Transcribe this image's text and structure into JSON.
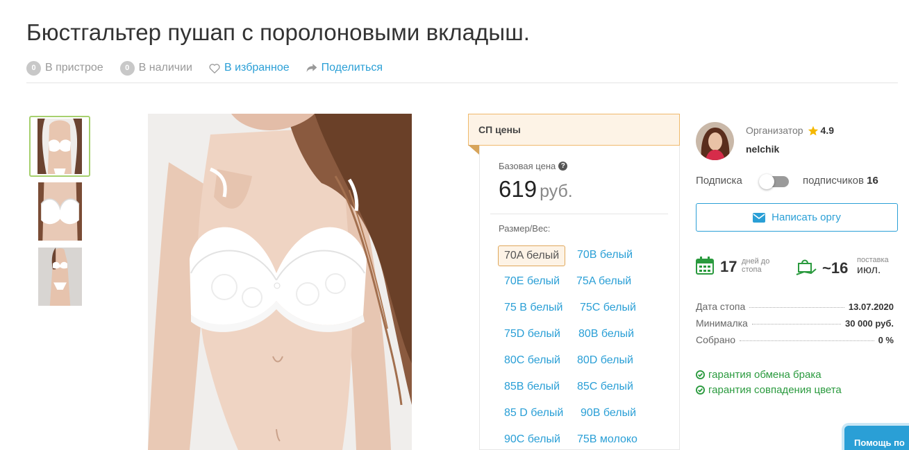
{
  "product": {
    "title": "Бюстгальтер пушап с поролоновыми вкладыш."
  },
  "actions": {
    "attach_count": "0",
    "attach_label": "В пристрое",
    "stock_count": "0",
    "stock_label": "В наличии",
    "favorite_label": "В избранное",
    "share_label": "Поделиться"
  },
  "gallery": {
    "thumbnails": [
      "thumb-front",
      "thumb-closeup",
      "thumb-full"
    ],
    "active_index": 0
  },
  "prices": {
    "header": "СП цены",
    "base_label": "Базовая цена",
    "price": "619",
    "currency": "руб.",
    "size_label": "Размер/Вес:",
    "sizes": [
      "70A белый",
      "70B белый",
      "70E белый",
      "75A белый",
      "75 B белый",
      "75C белый",
      "75D белый",
      "80B белый",
      "80C белый",
      "80D белый",
      "85B белый",
      "85C белый",
      "85 D белый",
      "90B белый",
      "90C белый",
      "75B молоко"
    ],
    "selected_size": "70A белый"
  },
  "organizer": {
    "label": "Организатор",
    "rating": "4.9",
    "name": "nelchik",
    "subscribe_label": "Подписка",
    "subscribe_on": false,
    "subscribers_label": "подписчиков",
    "subscribers_count": "16",
    "message_button": "Написать оргу"
  },
  "stats": {
    "days_to_stop": "17",
    "days_label_1": "дней до",
    "days_label_2": "стопа",
    "delivery_num": "~16",
    "delivery_label": "поставка",
    "delivery_month": "июл."
  },
  "info": [
    {
      "label": "Дата стопа",
      "value": "13.07.2020"
    },
    {
      "label": "Минималка",
      "value": "30 000 руб."
    },
    {
      "label": "Собрано",
      "value": "0 %"
    }
  ],
  "guarantees": [
    "гарантия обмена брака",
    "гарантия совпадения цвета"
  ],
  "help_button": "Помощь по",
  "colors": {
    "accent": "#2a9fd6",
    "green": "#2a9a3e",
    "orange_border": "#e0a75a",
    "price_head_bg": "#fdf3e6"
  }
}
